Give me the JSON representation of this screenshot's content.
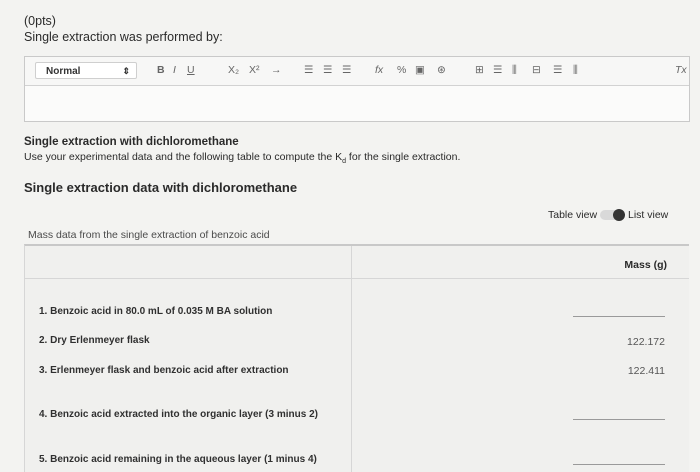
{
  "question": {
    "points": "(0pts)",
    "text": "Single extraction was performed by:"
  },
  "editor": {
    "format_value": "Normal",
    "toolbar_glyphs": {
      "bold": "B",
      "italic": "I",
      "underline": "U",
      "subscript": "X₂",
      "superscript": "X²",
      "arrow": "→",
      "list_ordered": "☰",
      "list_bullet": "☰",
      "align": "☰",
      "formula": "fx",
      "link": "%",
      "image": "▣",
      "embed": "⊛",
      "table": "⊞",
      "table_row": "☰",
      "table_col": "⫼",
      "table_merge": "⊟",
      "table_split": "☰",
      "table_more": "⫼",
      "clear_format": "Tx"
    }
  },
  "section": {
    "title": "Single extraction with dichloromethane",
    "description_pre": "Use your experimental data and the following table to compute the K",
    "description_sub": "d",
    "description_post": " for the single extraction.",
    "data_title": "Single extraction data with dichloromethane"
  },
  "view_toggle": {
    "table_view": "Table view",
    "list_view": "List view",
    "selected": "List view"
  },
  "table": {
    "caption": "Mass data from the single extraction of benzoic acid",
    "column_header": "Mass (g)",
    "rows": [
      {
        "label": "1. Benzoic acid in 80.0 mL of 0.035 M BA solution",
        "value": ""
      },
      {
        "label": "2. Dry Erlenmeyer flask",
        "value": "122.172"
      },
      {
        "label": "3. Erlenmeyer flask and benzoic acid after extraction",
        "value": "122.411"
      },
      {
        "label": "4. Benzoic acid extracted into the organic layer (3 minus 2)",
        "value": ""
      },
      {
        "label": "5. Benzoic acid remaining in the aqueous layer (1 minus 4)",
        "value": ""
      }
    ]
  }
}
